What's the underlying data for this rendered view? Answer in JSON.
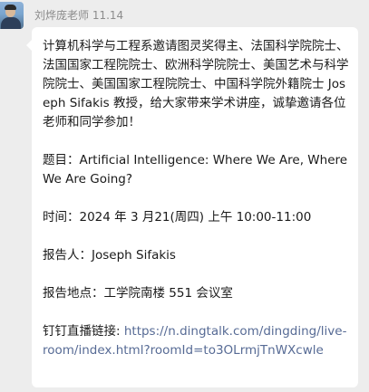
{
  "sender": {
    "name": "刘烨庞老师 11.14"
  },
  "message": {
    "intro": "计算机科学与工程系邀请图灵奖得主、法国科学院院士、法国国家工程院院士、欧洲科学院院士、美国艺术与科学院院士、美国国家工程院院士、中国科学院外籍院士 Joseph Sifakis 教授，给大家带来学术讲座，诚挚邀请各位老师和同学参加！",
    "title_label": "题目：",
    "title_value": "Artificial Intelligence: Where We Are, Where We Are Going?",
    "time_label": "时间：",
    "time_value": "2024 年 3 月21(周四) 上午 10:00-11:00",
    "speaker_label": "报告人：",
    "speaker_value": "Joseph Sifakis",
    "location_label": "报告地点：",
    "location_value": "工学院南楼 551 会议室",
    "stream_label": "钉钉直播链接: ",
    "stream_url": "https://n.dingtalk.com/dingding/live-room/index.html?roomId=to3OLrmjTnWXcwle"
  }
}
